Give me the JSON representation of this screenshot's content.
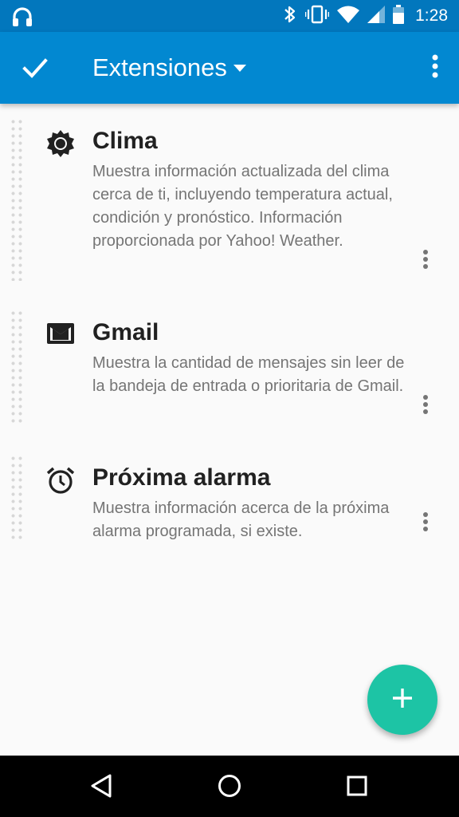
{
  "status_bar": {
    "time": "1:28",
    "icons": [
      "headphones-icon",
      "bluetooth-icon",
      "vibrate-icon",
      "wifi-icon",
      "cell-signal-icon",
      "battery-icon"
    ]
  },
  "toolbar": {
    "title": "Extensiones",
    "accent_color": "#0288d1",
    "status_color": "#0277bd"
  },
  "extensions": [
    {
      "title": "Clima",
      "icon": "sun-icon",
      "description": "Muestra información actualizada del clima cerca de ti, incluyendo temperatura actual, condición y pronóstico. Información proporcionada por Yahoo! Weather."
    },
    {
      "title": "Gmail",
      "icon": "mail-icon",
      "description": "Muestra la cantidad de mensajes sin leer de la bandeja de entrada o prioritaria de Gmail."
    },
    {
      "title": "Próxima alarma",
      "icon": "alarm-clock-icon",
      "description": "Muestra información acerca de la próxima alarma programada, si existe."
    }
  ],
  "fab": {
    "icon": "plus-icon",
    "color": "#1dc4a5"
  },
  "nav_bar": {
    "icons": [
      "back-icon",
      "home-icon",
      "recents-icon"
    ]
  }
}
